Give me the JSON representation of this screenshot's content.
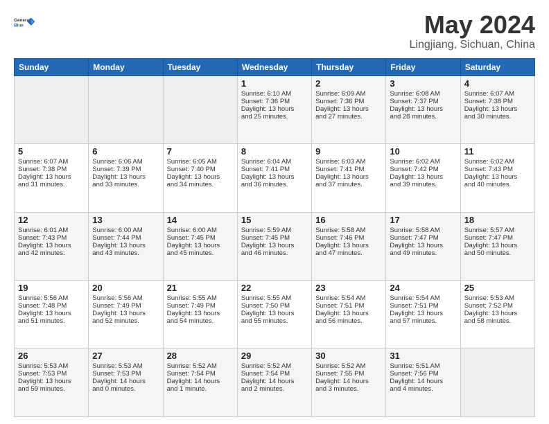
{
  "logo": {
    "line1": "General",
    "line2": "Blue"
  },
  "title": "May 2024",
  "subtitle": "Lingjiang, Sichuan, China",
  "weekdays": [
    "Sunday",
    "Monday",
    "Tuesday",
    "Wednesday",
    "Thursday",
    "Friday",
    "Saturday"
  ],
  "weeks": [
    [
      {
        "day": null,
        "text": null
      },
      {
        "day": null,
        "text": null
      },
      {
        "day": null,
        "text": null
      },
      {
        "day": "1",
        "text": "Sunrise: 6:10 AM\nSunset: 7:36 PM\nDaylight: 13 hours\nand 25 minutes."
      },
      {
        "day": "2",
        "text": "Sunrise: 6:09 AM\nSunset: 7:36 PM\nDaylight: 13 hours\nand 27 minutes."
      },
      {
        "day": "3",
        "text": "Sunrise: 6:08 AM\nSunset: 7:37 PM\nDaylight: 13 hours\nand 28 minutes."
      },
      {
        "day": "4",
        "text": "Sunrise: 6:07 AM\nSunset: 7:38 PM\nDaylight: 13 hours\nand 30 minutes."
      }
    ],
    [
      {
        "day": "5",
        "text": "Sunrise: 6:07 AM\nSunset: 7:38 PM\nDaylight: 13 hours\nand 31 minutes."
      },
      {
        "day": "6",
        "text": "Sunrise: 6:06 AM\nSunset: 7:39 PM\nDaylight: 13 hours\nand 33 minutes."
      },
      {
        "day": "7",
        "text": "Sunrise: 6:05 AM\nSunset: 7:40 PM\nDaylight: 13 hours\nand 34 minutes."
      },
      {
        "day": "8",
        "text": "Sunrise: 6:04 AM\nSunset: 7:41 PM\nDaylight: 13 hours\nand 36 minutes."
      },
      {
        "day": "9",
        "text": "Sunrise: 6:03 AM\nSunset: 7:41 PM\nDaylight: 13 hours\nand 37 minutes."
      },
      {
        "day": "10",
        "text": "Sunrise: 6:02 AM\nSunset: 7:42 PM\nDaylight: 13 hours\nand 39 minutes."
      },
      {
        "day": "11",
        "text": "Sunrise: 6:02 AM\nSunset: 7:43 PM\nDaylight: 13 hours\nand 40 minutes."
      }
    ],
    [
      {
        "day": "12",
        "text": "Sunrise: 6:01 AM\nSunset: 7:43 PM\nDaylight: 13 hours\nand 42 minutes."
      },
      {
        "day": "13",
        "text": "Sunrise: 6:00 AM\nSunset: 7:44 PM\nDaylight: 13 hours\nand 43 minutes."
      },
      {
        "day": "14",
        "text": "Sunrise: 6:00 AM\nSunset: 7:45 PM\nDaylight: 13 hours\nand 45 minutes."
      },
      {
        "day": "15",
        "text": "Sunrise: 5:59 AM\nSunset: 7:45 PM\nDaylight: 13 hours\nand 46 minutes."
      },
      {
        "day": "16",
        "text": "Sunrise: 5:58 AM\nSunset: 7:46 PM\nDaylight: 13 hours\nand 47 minutes."
      },
      {
        "day": "17",
        "text": "Sunrise: 5:58 AM\nSunset: 7:47 PM\nDaylight: 13 hours\nand 49 minutes."
      },
      {
        "day": "18",
        "text": "Sunrise: 5:57 AM\nSunset: 7:47 PM\nDaylight: 13 hours\nand 50 minutes."
      }
    ],
    [
      {
        "day": "19",
        "text": "Sunrise: 5:56 AM\nSunset: 7:48 PM\nDaylight: 13 hours\nand 51 minutes."
      },
      {
        "day": "20",
        "text": "Sunrise: 5:56 AM\nSunset: 7:49 PM\nDaylight: 13 hours\nand 52 minutes."
      },
      {
        "day": "21",
        "text": "Sunrise: 5:55 AM\nSunset: 7:49 PM\nDaylight: 13 hours\nand 54 minutes."
      },
      {
        "day": "22",
        "text": "Sunrise: 5:55 AM\nSunset: 7:50 PM\nDaylight: 13 hours\nand 55 minutes."
      },
      {
        "day": "23",
        "text": "Sunrise: 5:54 AM\nSunset: 7:51 PM\nDaylight: 13 hours\nand 56 minutes."
      },
      {
        "day": "24",
        "text": "Sunrise: 5:54 AM\nSunset: 7:51 PM\nDaylight: 13 hours\nand 57 minutes."
      },
      {
        "day": "25",
        "text": "Sunrise: 5:53 AM\nSunset: 7:52 PM\nDaylight: 13 hours\nand 58 minutes."
      }
    ],
    [
      {
        "day": "26",
        "text": "Sunrise: 5:53 AM\nSunset: 7:53 PM\nDaylight: 13 hours\nand 59 minutes."
      },
      {
        "day": "27",
        "text": "Sunrise: 5:53 AM\nSunset: 7:53 PM\nDaylight: 14 hours\nand 0 minutes."
      },
      {
        "day": "28",
        "text": "Sunrise: 5:52 AM\nSunset: 7:54 PM\nDaylight: 14 hours\nand 1 minute."
      },
      {
        "day": "29",
        "text": "Sunrise: 5:52 AM\nSunset: 7:54 PM\nDaylight: 14 hours\nand 2 minutes."
      },
      {
        "day": "30",
        "text": "Sunrise: 5:52 AM\nSunset: 7:55 PM\nDaylight: 14 hours\nand 3 minutes."
      },
      {
        "day": "31",
        "text": "Sunrise: 5:51 AM\nSunset: 7:56 PM\nDaylight: 14 hours\nand 4 minutes."
      },
      {
        "day": null,
        "text": null
      }
    ]
  ]
}
